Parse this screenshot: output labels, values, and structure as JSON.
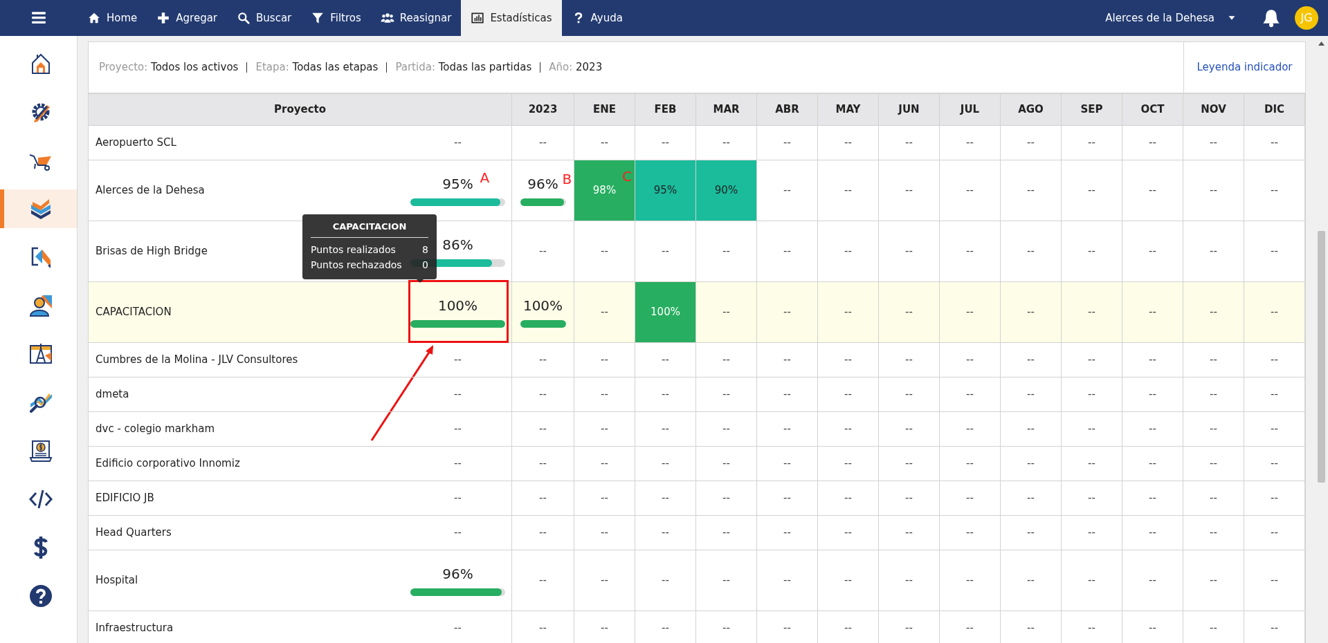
{
  "navbar": {
    "items": [
      {
        "kind": "home",
        "label": "Home",
        "selected": false
      },
      {
        "kind": "add",
        "label": "Agregar",
        "selected": false
      },
      {
        "kind": "search",
        "label": "Buscar",
        "selected": false
      },
      {
        "kind": "filter",
        "label": "Filtros",
        "selected": false
      },
      {
        "kind": "users",
        "label": "Reasignar",
        "selected": false
      },
      {
        "kind": "chart",
        "label": "Estadísticas",
        "selected": true
      },
      {
        "kind": "help",
        "label": "Ayuda",
        "selected": false
      }
    ],
    "project_selector": "Alerces de la Dehesa",
    "avatar": "JG"
  },
  "sidebar": {
    "items": [
      {
        "kind": "home",
        "selected": false
      },
      {
        "kind": "settings",
        "selected": false
      },
      {
        "kind": "wheelbarrow",
        "selected": false
      },
      {
        "kind": "chevrons",
        "selected": true
      },
      {
        "kind": "export",
        "selected": false
      },
      {
        "kind": "user",
        "selected": false
      },
      {
        "kind": "drafting",
        "selected": false
      },
      {
        "kind": "inspection",
        "selected": false
      },
      {
        "kind": "billing",
        "selected": false
      },
      {
        "kind": "code",
        "selected": false
      },
      {
        "kind": "dollar",
        "selected": false
      },
      {
        "kind": "help",
        "selected": false
      }
    ]
  },
  "filters": [
    {
      "label": "Proyecto:",
      "value": "Todos los activos"
    },
    {
      "label": "Etapa:",
      "value": "Todas las etapas"
    },
    {
      "label": "Partida:",
      "value": "Todas las partidas"
    },
    {
      "label": "Año:",
      "value": "2023"
    }
  ],
  "legend_link": "Leyenda indicador",
  "table": {
    "columns": [
      "Proyecto",
      "2023",
      "ENE",
      "FEB",
      "MAR",
      "ABR",
      "MAY",
      "JUN",
      "JUL",
      "AGO",
      "SEP",
      "OCT",
      "NOV",
      "DIC"
    ],
    "rows": [
      {
        "name": "Aeropuerto SCL",
        "highlighted": false,
        "overall": {
          "text": "--"
        },
        "year": {
          "text": "--"
        },
        "months": [
          {
            "text": "--"
          },
          {
            "text": "--"
          },
          {
            "text": "--"
          },
          {
            "text": "--"
          },
          {
            "text": "--"
          },
          {
            "text": "--"
          },
          {
            "text": "--"
          },
          {
            "text": "--"
          },
          {
            "text": "--"
          },
          {
            "text": "--"
          },
          {
            "text": "--"
          },
          {
            "text": "--"
          }
        ]
      },
      {
        "name": "Alerces de la Dehesa",
        "highlighted": false,
        "overall": {
          "text": "95%",
          "level": 0.95,
          "color": "#1abc9c",
          "mark": "A"
        },
        "year": {
          "text": "96%",
          "level": 0.96,
          "color": "#27ae60",
          "mark": "B"
        },
        "months": [
          {
            "text": "98%",
            "color": "#27ae60",
            "mark": "C"
          },
          {
            "text": "95%",
            "color": "#1abc9c"
          },
          {
            "text": "90%",
            "color": "#1abc9c"
          },
          {
            "text": "--"
          },
          {
            "text": "--"
          },
          {
            "text": "--"
          },
          {
            "text": "--"
          },
          {
            "text": "--"
          },
          {
            "text": "--"
          },
          {
            "text": "--"
          },
          {
            "text": "--"
          },
          {
            "text": "--"
          }
        ]
      },
      {
        "name": "Brisas de High Bridge",
        "highlighted": false,
        "overall": {
          "text": "86%",
          "level": 0.86,
          "color": "#1abc9c"
        },
        "year": {
          "text": "--"
        },
        "months": [
          {
            "text": "--"
          },
          {
            "text": "--"
          },
          {
            "text": "--"
          },
          {
            "text": "--"
          },
          {
            "text": "--"
          },
          {
            "text": "--"
          },
          {
            "text": "--"
          },
          {
            "text": "--"
          },
          {
            "text": "--"
          },
          {
            "text": "--"
          },
          {
            "text": "--"
          },
          {
            "text": "--"
          }
        ]
      },
      {
        "name": "CAPACITACION",
        "highlighted": true,
        "overall": {
          "text": "100%",
          "level": 1,
          "color": "#27ae60",
          "outlined": true,
          "tooltip": {
            "title": "CAPACITACION",
            "rows": [
              {
                "label": "Puntos realizados",
                "value": "8"
              },
              {
                "label": "Puntos rechazados",
                "value": "0"
              }
            ]
          }
        },
        "year": {
          "text": "100%",
          "level": 1,
          "color": "#27ae60"
        },
        "months": [
          {
            "text": "--"
          },
          {
            "text": "100%",
            "color": "#27ae60"
          },
          {
            "text": "--"
          },
          {
            "text": "--"
          },
          {
            "text": "--"
          },
          {
            "text": "--"
          },
          {
            "text": "--"
          },
          {
            "text": "--"
          },
          {
            "text": "--"
          },
          {
            "text": "--"
          },
          {
            "text": "--"
          },
          {
            "text": "--"
          }
        ]
      },
      {
        "name": "Cumbres de la Molina - JLV Consultores",
        "highlighted": false,
        "overall": {
          "text": "--"
        },
        "year": {
          "text": "--"
        },
        "months": [
          {
            "text": "--"
          },
          {
            "text": "--"
          },
          {
            "text": "--"
          },
          {
            "text": "--"
          },
          {
            "text": "--"
          },
          {
            "text": "--"
          },
          {
            "text": "--"
          },
          {
            "text": "--"
          },
          {
            "text": "--"
          },
          {
            "text": "--"
          },
          {
            "text": "--"
          },
          {
            "text": "--"
          }
        ]
      },
      {
        "name": "dmeta",
        "highlighted": false,
        "overall": {
          "text": "--"
        },
        "year": {
          "text": "--"
        },
        "months": [
          {
            "text": "--"
          },
          {
            "text": "--"
          },
          {
            "text": "--"
          },
          {
            "text": "--"
          },
          {
            "text": "--"
          },
          {
            "text": "--"
          },
          {
            "text": "--"
          },
          {
            "text": "--"
          },
          {
            "text": "--"
          },
          {
            "text": "--"
          },
          {
            "text": "--"
          },
          {
            "text": "--"
          }
        ]
      },
      {
        "name": "dvc - colegio markham",
        "highlighted": false,
        "overall": {
          "text": "--"
        },
        "year": {
          "text": "--"
        },
        "months": [
          {
            "text": "--"
          },
          {
            "text": "--"
          },
          {
            "text": "--"
          },
          {
            "text": "--"
          },
          {
            "text": "--"
          },
          {
            "text": "--"
          },
          {
            "text": "--"
          },
          {
            "text": "--"
          },
          {
            "text": "--"
          },
          {
            "text": "--"
          },
          {
            "text": "--"
          },
          {
            "text": "--"
          }
        ]
      },
      {
        "name": "Edificio corporativo Innomiz",
        "highlighted": false,
        "overall": {
          "text": "--"
        },
        "year": {
          "text": "--"
        },
        "months": [
          {
            "text": "--"
          },
          {
            "text": "--"
          },
          {
            "text": "--"
          },
          {
            "text": "--"
          },
          {
            "text": "--"
          },
          {
            "text": "--"
          },
          {
            "text": "--"
          },
          {
            "text": "--"
          },
          {
            "text": "--"
          },
          {
            "text": "--"
          },
          {
            "text": "--"
          },
          {
            "text": "--"
          }
        ]
      },
      {
        "name": "EDIFICIO JB",
        "highlighted": false,
        "overall": {
          "text": "--"
        },
        "year": {
          "text": "--"
        },
        "months": [
          {
            "text": "--"
          },
          {
            "text": "--"
          },
          {
            "text": "--"
          },
          {
            "text": "--"
          },
          {
            "text": "--"
          },
          {
            "text": "--"
          },
          {
            "text": "--"
          },
          {
            "text": "--"
          },
          {
            "text": "--"
          },
          {
            "text": "--"
          },
          {
            "text": "--"
          },
          {
            "text": "--"
          }
        ]
      },
      {
        "name": "Head Quarters",
        "highlighted": false,
        "overall": {
          "text": "--"
        },
        "year": {
          "text": "--"
        },
        "months": [
          {
            "text": "--"
          },
          {
            "text": "--"
          },
          {
            "text": "--"
          },
          {
            "text": "--"
          },
          {
            "text": "--"
          },
          {
            "text": "--"
          },
          {
            "text": "--"
          },
          {
            "text": "--"
          },
          {
            "text": "--"
          },
          {
            "text": "--"
          },
          {
            "text": "--"
          },
          {
            "text": "--"
          }
        ]
      },
      {
        "name": "Hospital",
        "highlighted": false,
        "overall": {
          "text": "96%",
          "level": 0.96,
          "color": "#27ae60"
        },
        "year": {
          "text": "--"
        },
        "months": [
          {
            "text": "--"
          },
          {
            "text": "--"
          },
          {
            "text": "--"
          },
          {
            "text": "--"
          },
          {
            "text": "--"
          },
          {
            "text": "--"
          },
          {
            "text": "--"
          },
          {
            "text": "--"
          },
          {
            "text": "--"
          },
          {
            "text": "--"
          },
          {
            "text": "--"
          },
          {
            "text": "--"
          }
        ]
      },
      {
        "name": "Infraestructura",
        "highlighted": false,
        "overall": {
          "text": "--"
        },
        "year": {
          "text": "--"
        },
        "months": [
          {
            "text": "--"
          },
          {
            "text": "--"
          },
          {
            "text": "--"
          },
          {
            "text": "--"
          },
          {
            "text": "--"
          },
          {
            "text": "--"
          },
          {
            "text": "--"
          },
          {
            "text": "--"
          },
          {
            "text": "--"
          },
          {
            "text": "--"
          },
          {
            "text": "--"
          },
          {
            "text": "--"
          }
        ]
      }
    ]
  }
}
